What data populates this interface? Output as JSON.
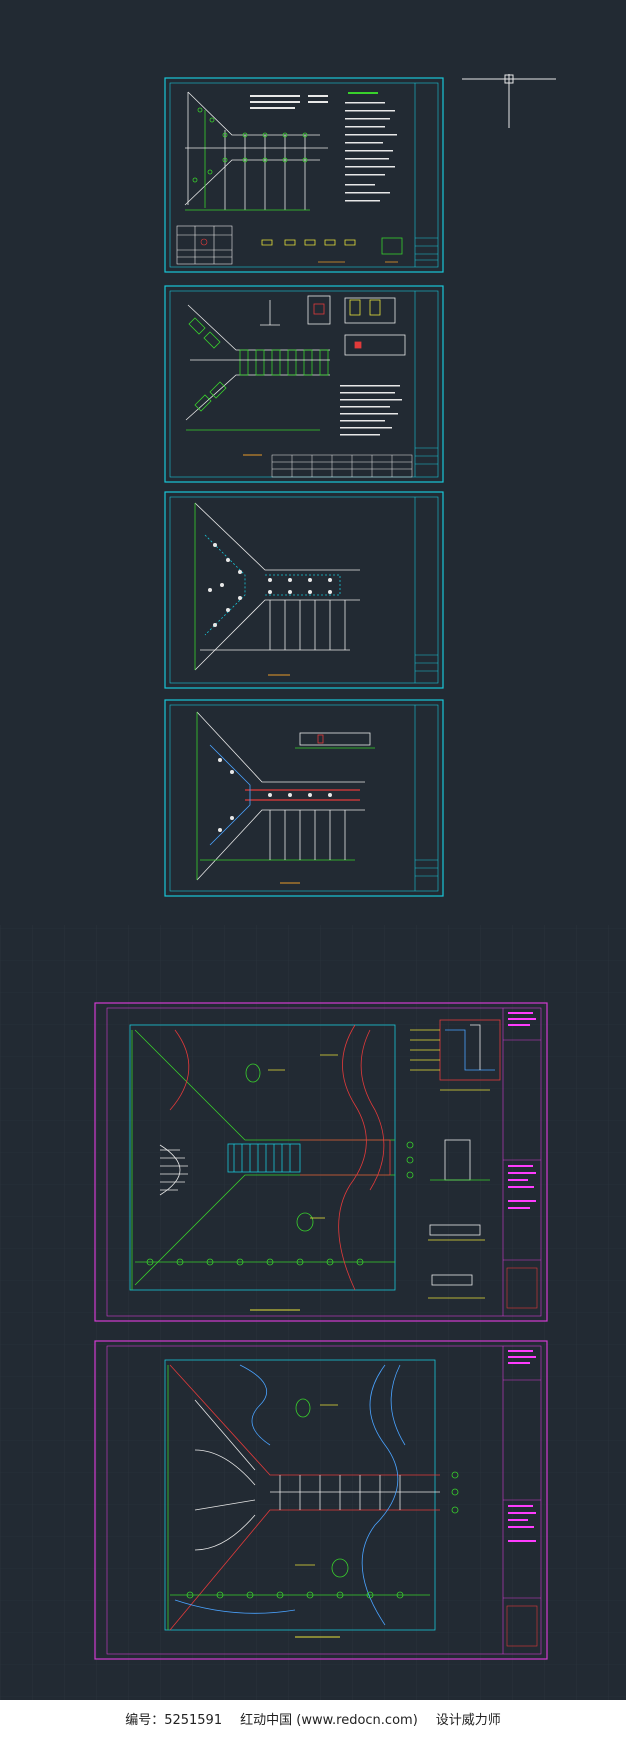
{
  "colors": {
    "background": "#222a33",
    "grid": "#2c3540",
    "sheet_frame": "#19c6d8",
    "sheet_frame_magenta": "#d23cd2",
    "line_white": "#e8e8e8",
    "line_green": "#39d12c",
    "line_red": "#e23a3a",
    "line_yellow": "#e8e23a",
    "line_blue": "#4aa3ff",
    "line_orange": "#e89a2a",
    "title_magenta": "#ff3cff",
    "footer_bg": "#ffffff",
    "footer_text": "#222222"
  },
  "sheets": [
    {
      "id": "sheet-1",
      "type": "structural-plan",
      "frame_color": "cyan"
    },
    {
      "id": "sheet-2",
      "type": "foundation-plan",
      "frame_color": "cyan"
    },
    {
      "id": "sheet-3",
      "type": "framing-plan",
      "frame_color": "cyan"
    },
    {
      "id": "sheet-4",
      "type": "roof-plan",
      "frame_color": "cyan"
    },
    {
      "id": "sheet-5",
      "type": "site-plan",
      "frame_color": "magenta"
    },
    {
      "id": "sheet-6",
      "type": "site-plan",
      "frame_color": "magenta"
    }
  ],
  "footer": {
    "id_label": "编号：5251591",
    "site_label": "红动中国 (www.redocn.com)",
    "designer_label": "设计威力师"
  }
}
